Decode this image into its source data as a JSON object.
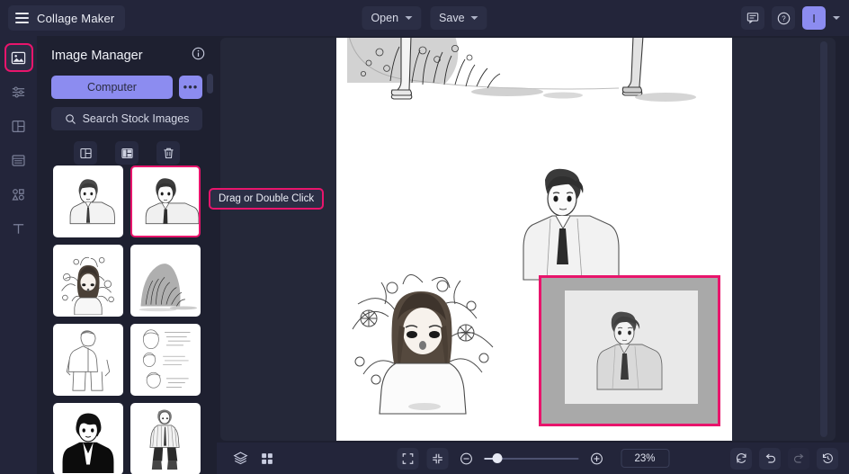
{
  "app": {
    "title": "Collage Maker",
    "menu_icon": "hamburger-icon"
  },
  "topbar": {
    "open_label": "Open",
    "save_label": "Save",
    "chat_icon": "chat-icon",
    "help_icon": "help-icon",
    "avatar_initial": "I",
    "avatar_color": "#8c8cf0"
  },
  "rail": {
    "items": [
      {
        "name": "image-manager",
        "icon": "image-icon",
        "active": true
      },
      {
        "name": "adjustments",
        "icon": "sliders-icon",
        "active": false
      },
      {
        "name": "layouts",
        "icon": "layout-icon",
        "active": false
      },
      {
        "name": "templates",
        "icon": "list-icon",
        "active": false
      },
      {
        "name": "shapes",
        "icon": "shapes-icon",
        "active": false
      },
      {
        "name": "text",
        "icon": "text-icon",
        "active": false
      }
    ],
    "active_outline_color": "#e8156c"
  },
  "panel": {
    "title": "Image Manager",
    "info_icon": "info-icon",
    "computer_label": "Computer",
    "more_label": "•••",
    "search_label": "Search Stock Images",
    "search_icon": "search-icon",
    "tools": [
      {
        "name": "grid-layout-button",
        "icon": "layout-outline-icon"
      },
      {
        "name": "split-layout-button",
        "icon": "layout-filled-icon"
      },
      {
        "name": "delete-button",
        "icon": "trash-icon"
      }
    ],
    "thumbnails": [
      {
        "id": 1,
        "alt": "boy-portrait-sketch",
        "selected": false
      },
      {
        "id": 2,
        "alt": "boy-portrait-tie-sketch",
        "selected": true
      },
      {
        "id": 3,
        "alt": "girl-flowers-sketch",
        "selected": false
      },
      {
        "id": 4,
        "alt": "grass-field-sketch",
        "selected": false
      },
      {
        "id": 5,
        "alt": "standing-figure-sketch",
        "selected": false
      },
      {
        "id": 6,
        "alt": "face-studies-notes-sketch",
        "selected": false
      },
      {
        "id": 7,
        "alt": "black-coat-portrait-sketch",
        "selected": false
      },
      {
        "id": 8,
        "alt": "striped-outfit-figure-sketch",
        "selected": false
      }
    ]
  },
  "tooltip": {
    "text": "Drag or Double Click",
    "border_color": "#e8156c"
  },
  "canvas": {
    "selection_border_color": "#e8156c",
    "frame_bg": "#a9a9a9",
    "frame_inner_bg": "#e9e9e9",
    "page_bg": "#ffffff"
  },
  "bottombar": {
    "layers_icon": "layers-icon",
    "grid_icon": "grid-icon",
    "fullscreen_icon": "fullscreen-icon",
    "fit_icon": "fit-screen-icon",
    "zoom_out_icon": "zoom-out-icon",
    "zoom_in_icon": "zoom-in-icon",
    "zoom_value": "23%",
    "reset_icon": "reset-icon",
    "undo_icon": "undo-icon",
    "redo_icon": "redo-icon",
    "history_icon": "history-icon"
  }
}
